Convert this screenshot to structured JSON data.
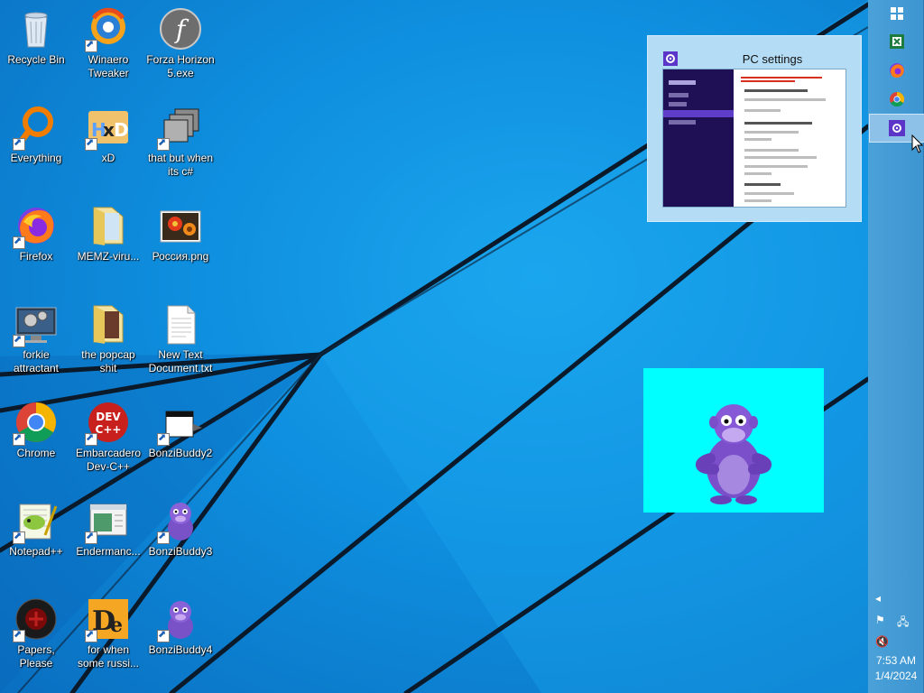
{
  "desktop": {
    "icons": [
      {
        "label": "Recycle Bin",
        "icon": "recycle-bin-icon"
      },
      {
        "label": "Winaero Tweaker",
        "icon": "winaero-tweaker-icon"
      },
      {
        "label": "Forza Horizon 5.exe",
        "icon": "flash-icon"
      },
      {
        "label": "Everything",
        "icon": "everything-search-icon"
      },
      {
        "label": "xD",
        "icon": "hxd-icon"
      },
      {
        "label": "that but when its c#",
        "icon": "windows-stack-icon"
      },
      {
        "label": "Firefox",
        "icon": "firefox-icon"
      },
      {
        "label": "MEMZ-viru...",
        "icon": "folder-icon"
      },
      {
        "label": "Россия.png",
        "icon": "flower-image-icon"
      },
      {
        "label": "forkie attractant",
        "icon": "settings-monitor-icon"
      },
      {
        "label": "the popcap shit",
        "icon": "folder-icon"
      },
      {
        "label": "New Text Document.txt",
        "icon": "text-file-icon"
      },
      {
        "label": "Chrome",
        "icon": "chrome-icon"
      },
      {
        "label": "Embarcadero Dev-C++",
        "icon": "devcpp-icon"
      },
      {
        "label": "BonziBuddy2",
        "icon": "window-film-icon"
      },
      {
        "label": "Notepad++",
        "icon": "notepadpp-icon"
      },
      {
        "label": "Endermanc...",
        "icon": "window-app-icon"
      },
      {
        "label": "BonziBuddy3",
        "icon": "bonzi-icon"
      },
      {
        "label": "Papers, Please",
        "icon": "papers-please-icon"
      },
      {
        "label": "for when some russi...",
        "icon": "de-icon"
      },
      {
        "label": "BonziBuddy4",
        "icon": "bonzi-icon"
      }
    ]
  },
  "taskbar": {
    "buttons": [
      {
        "name": "start-button",
        "icon": "windows-logo-icon"
      },
      {
        "name": "excel-button",
        "icon": "excel-icon"
      },
      {
        "name": "firefox-button",
        "icon": "firefox-icon"
      },
      {
        "name": "chrome-button",
        "icon": "chrome-icon"
      },
      {
        "name": "pc-settings-button",
        "icon": "gear-icon",
        "active": true
      }
    ],
    "clock": {
      "time": "7:53 AM",
      "date": "1/4/2024"
    }
  },
  "preview": {
    "title": "PC settings"
  },
  "colors": {
    "taskbar": "#3d95d1",
    "accent_purple": "#5a35c8",
    "bonzi_bg": "#00ffff"
  }
}
